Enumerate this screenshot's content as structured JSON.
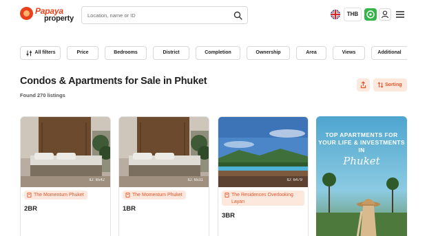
{
  "header": {
    "logo_line1": "Papaya",
    "logo_line2": "property",
    "search_placeholder": "Location, name or ID",
    "currency": "THB"
  },
  "filters": [
    "All filters",
    "Price",
    "Bedrooms",
    "District",
    "Completion",
    "Ownership",
    "Area",
    "Views",
    "Additional"
  ],
  "page": {
    "title": "Condos & Apartments for Sale in Phuket",
    "found": "Found 270 listings",
    "sorting_label": "Sorting"
  },
  "listings": [
    {
      "id_label": "ID: 6542",
      "project": "The Momentum Phuket",
      "bedrooms": "2BR"
    },
    {
      "id_label": "ID: 6531",
      "project": "The Momentum Phuket",
      "bedrooms": "1BR"
    },
    {
      "id_label": "ID: 6479",
      "project": "The Residences Overlooking Layan",
      "bedrooms": "3BR"
    }
  ],
  "promo": {
    "headline": "TOP APARTMENTS FOR YOUR LIFE & INVESTMENTS IN",
    "script": "Phuket"
  },
  "colors": {
    "brand": "#e8411c",
    "accent_bg": "#fde8de",
    "accent_text": "#e2562a",
    "whatsapp": "#35b44a"
  }
}
